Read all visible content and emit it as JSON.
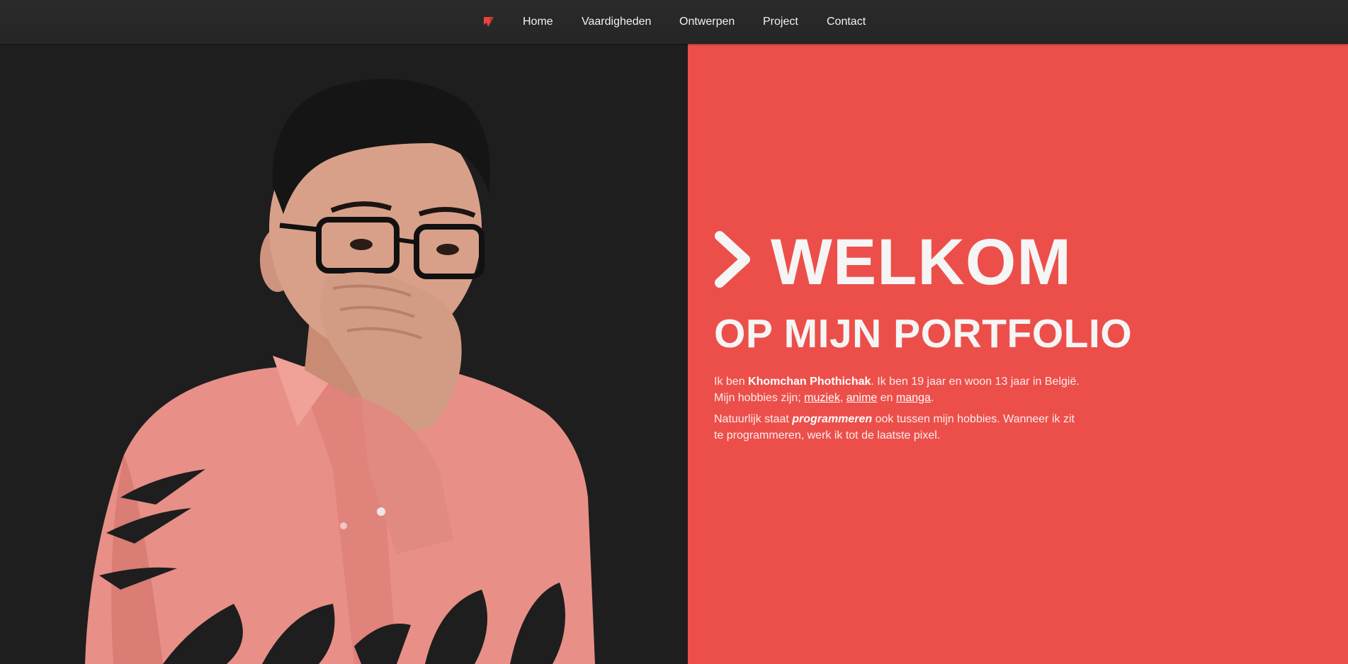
{
  "nav": {
    "logo": "brand-logo-icon",
    "items": [
      {
        "label": "Home"
      },
      {
        "label": "Vaardigheden"
      },
      {
        "label": "Ontwerpen"
      },
      {
        "label": "Project"
      },
      {
        "label": "Contact"
      }
    ]
  },
  "hero": {
    "photo": "portrait-photo",
    "title_line1": "WELKOM",
    "title_line2": "OP MIJN PORTFOLIO",
    "paragraph1": {
      "t1": "Ik ben ",
      "name": "Khomchan Phothichak",
      "t2": ". Ik ben 19 jaar en woon 13 jaar in België. Mijn hobbies zijn; ",
      "hobby1": "muziek",
      "sep1": ", ",
      "hobby2": "anime",
      "sep2": " en ",
      "hobby3": "manga",
      "end": "."
    },
    "paragraph2": {
      "t1": "Natuurlijk staat ",
      "emphasis": "programmeren",
      "t2": " ook tussen mijn hobbies. Wanneer ik zit te programmeren, werk ik tot de laatste pixel."
    }
  },
  "colors": {
    "accent": "#ec4f4a",
    "nav_bg": "#282828",
    "dark_bg": "#1e1e1e",
    "text_light": "#f5f5f5",
    "shirt": "#e89088",
    "skin": "#d9a089",
    "hair": "#151515"
  }
}
